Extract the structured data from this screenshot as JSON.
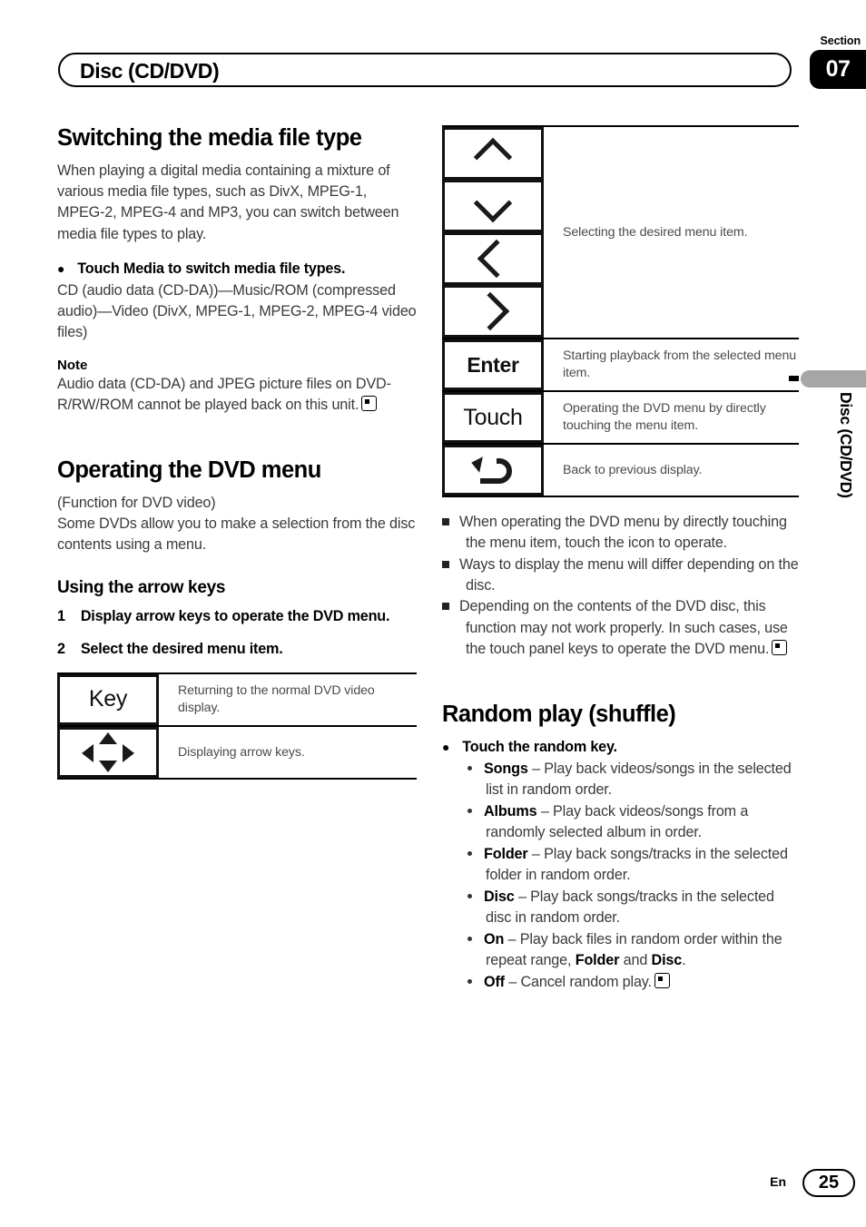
{
  "header": {
    "title": "Disc (CD/DVD)",
    "section_label": "Section",
    "section_number": "07"
  },
  "side_tab": {
    "label": "Disc (CD/DVD)"
  },
  "footer": {
    "language": "En",
    "page_number": "25"
  },
  "left_column": {
    "heading_media": "Switching the media file type",
    "intro_paragraph": "When playing a digital media containing a mixture of various media file types, such as DivX, MPEG-1, MPEG-2, MPEG-4 and MP3, you can switch between media file types to play.",
    "bullet_touch_media": "Touch Media to switch media file types.",
    "media_chain": "CD (audio data (CD-DA))—Music/ROM (compressed audio)—Video (DivX, MPEG-1, MPEG-2, MPEG-4 video files)",
    "note_heading": "Note",
    "note_text": "Audio data (CD-DA) and JPEG picture files on DVD-R/RW/ROM cannot be played back on this unit.",
    "heading_dvd_menu": "Operating the DVD menu",
    "dvd_menu_function": "(Function for DVD video)",
    "dvd_menu_text": "Some DVDs allow you to make a selection from the disc contents using a menu.",
    "heading_arrow_keys": "Using the arrow keys",
    "step1_num": "1",
    "step1_text": "Display arrow keys to operate the DVD menu.",
    "step2_num": "2",
    "step2_text": "Select the desired menu item.",
    "key_table": [
      {
        "key_label": "Key",
        "icon": "",
        "description": "Returning to the normal DVD video display."
      },
      {
        "key_label": "",
        "icon": "arrow-pad-icon",
        "description": "Displaying arrow keys."
      }
    ]
  },
  "right_column": {
    "key_table": [
      {
        "icons": [
          "chevron-up-icon",
          "chevron-down-icon",
          "chevron-left-icon",
          "chevron-right-icon"
        ],
        "description": "Selecting the desired menu item."
      },
      {
        "key_label": "Enter",
        "description": "Starting playback from the selected menu item."
      },
      {
        "key_label": "Touch",
        "description": "Operating the DVD menu by directly touching the menu item."
      },
      {
        "icons": [
          "back-arrow-icon"
        ],
        "description": "Back to previous display."
      }
    ],
    "notes": [
      "When operating the DVD menu by directly touching the menu item, touch the icon to operate.",
      "Ways to display the menu will differ depending on the disc.",
      "Depending on the contents of the DVD disc, this function may not work properly. In such cases, use the touch panel keys to operate the DVD menu."
    ],
    "heading_random": "Random play (shuffle)",
    "bullet_random_key": "Touch the random key.",
    "random_options": [
      {
        "term": "Songs",
        "desc": " – Play back videos/songs in the selected list in random order."
      },
      {
        "term": "Albums",
        "desc": " – Play back videos/songs from a randomly selected album in order."
      },
      {
        "term": "Folder",
        "desc": " – Play back songs/tracks in the selected folder in random order."
      },
      {
        "term": "Disc",
        "desc": " – Play back songs/tracks in the selected disc in random order."
      },
      {
        "term": "On",
        "desc": " – Play back files in random order within the repeat range, Folder and Disc."
      },
      {
        "term": "Off",
        "desc": " – Cancel random play."
      }
    ]
  }
}
